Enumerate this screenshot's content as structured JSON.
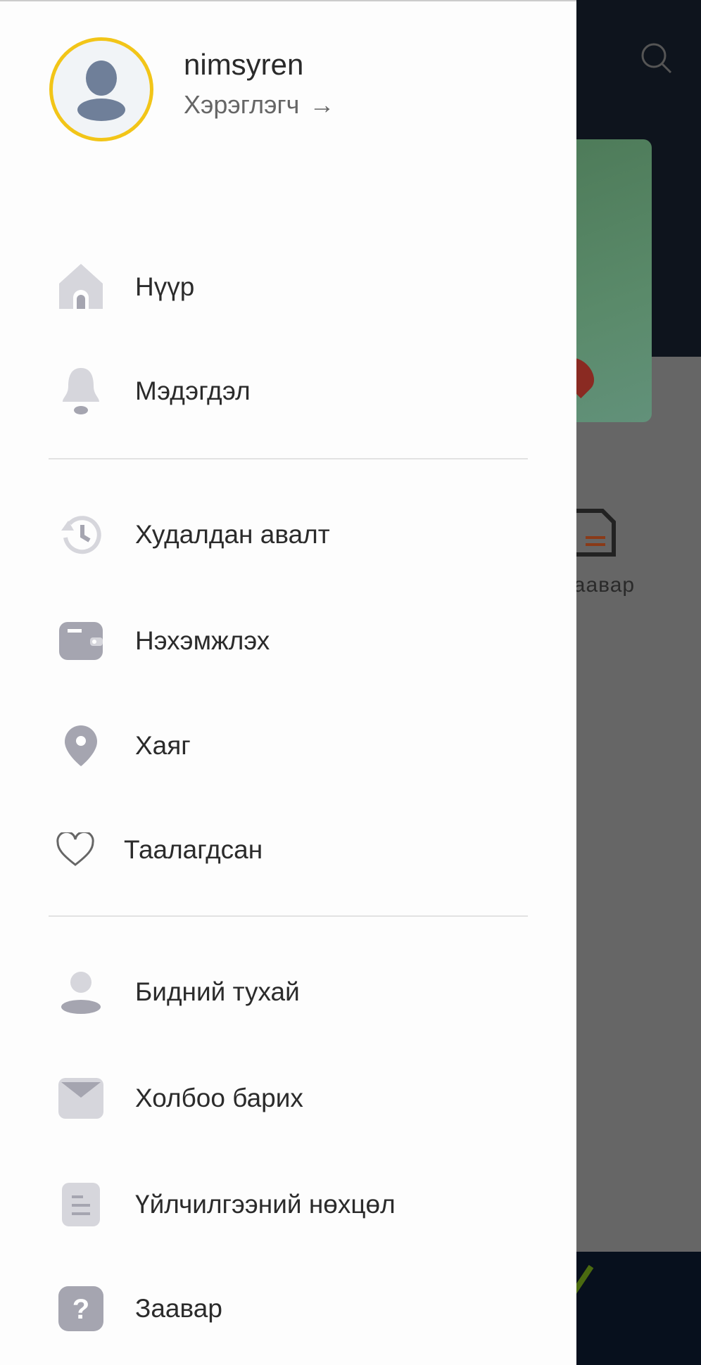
{
  "background": {
    "partial_label": "заавар"
  },
  "profile": {
    "username": "nimsyren",
    "role": "Хэрэглэгч",
    "arrow": "→"
  },
  "menu": {
    "group1": [
      {
        "label": "Нүүр",
        "icon": "home-icon"
      },
      {
        "label": "Мэдэгдэл",
        "icon": "bell-icon"
      }
    ],
    "group2": [
      {
        "label": "Худалдан авалт",
        "icon": "history-icon"
      },
      {
        "label": "Нэхэмжлэх",
        "icon": "wallet-icon"
      },
      {
        "label": "Хаяг",
        "icon": "location-pin-icon"
      },
      {
        "label": "Таалагдсан",
        "icon": "heart-icon"
      }
    ],
    "group3": [
      {
        "label": "Бидний тухай",
        "icon": "person-icon"
      },
      {
        "label": "Холбоо барих",
        "icon": "mail-icon"
      },
      {
        "label": "Үйлчилгээний нөхцөл",
        "icon": "document-icon"
      },
      {
        "label": "Заавар",
        "icon": "help-icon"
      }
    ]
  },
  "colors": {
    "avatar_ring": "#f2c518",
    "icon_gray": "#a5a5b0",
    "icon_light": "#d6d6dc"
  }
}
